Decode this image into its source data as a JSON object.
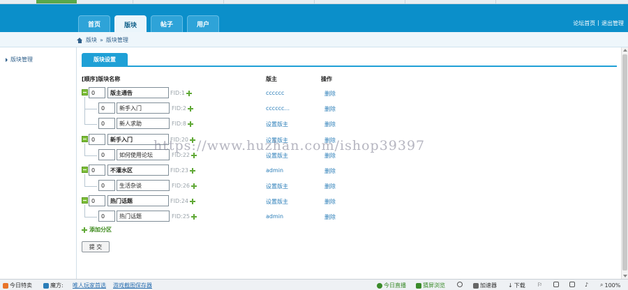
{
  "header": {
    "nav_tabs": [
      "首页",
      "版块",
      "帖子",
      "用户"
    ],
    "active_tab": "版块",
    "links": [
      "论坛首页",
      "|",
      "退出管理"
    ]
  },
  "breadcrumb": {
    "items": [
      "版块",
      "»",
      "版块管理"
    ]
  },
  "sidebar": {
    "items": [
      {
        "label": "版块管理"
      }
    ]
  },
  "panel": {
    "tab_label": "版块设置"
  },
  "columns": {
    "order_name": "[顺序]版块名称",
    "moderator": "版主",
    "action": "操作"
  },
  "rows": [
    {
      "level": 0,
      "order": "0",
      "name": "版主通告",
      "fid": "FID:1",
      "moderator": "cccccc",
      "action": "删除"
    },
    {
      "level": 1,
      "order": "0",
      "name": "新手入门",
      "fid": "FID:2",
      "moderator": "cccccc...",
      "action": "删除"
    },
    {
      "level": 1,
      "order": "0",
      "name": "新人求助",
      "fid": "FID:8",
      "moderator": "设置版主",
      "action": "删除"
    },
    {
      "level": 0,
      "order": "0",
      "name": "新手入门",
      "fid": "FID:20",
      "moderator": "设置版主",
      "action": "删除"
    },
    {
      "level": 1,
      "order": "0",
      "name": "如何使用论坛",
      "fid": "FID:22",
      "moderator": "设置版主",
      "action": "删除"
    },
    {
      "level": 0,
      "order": "0",
      "name": "不灌水区",
      "fid": "FID:23",
      "moderator": "admin",
      "action": "删除"
    },
    {
      "level": 1,
      "order": "0",
      "name": "生活杂谈",
      "fid": "FID:26",
      "moderator": "设置版主",
      "action": "删除"
    },
    {
      "level": 0,
      "order": "0",
      "name": "热门话题",
      "fid": "FID:24",
      "moderator": "设置版主",
      "action": "删除"
    },
    {
      "level": 1,
      "order": "0",
      "name": "热门话题",
      "fid": "FID:25",
      "moderator": "admin",
      "action": "删除"
    }
  ],
  "add_category": "添加分区",
  "submit": "提 交",
  "watermark": "https://www.huzhan.com/ishop39397",
  "statusbar": {
    "left1": "今日特卖",
    "left2": "魔方:",
    "link1": "唯人玩家首选",
    "link2": "游戏截图保存器",
    "right": [
      "今日直播",
      "猜屏浏览",
      "加速器",
      "下载",
      "100%"
    ]
  },
  "colors": {
    "header_bg": "#0b8fca",
    "tab_active": "#1fa0d6",
    "link": "#2a7db8",
    "plus": "#5fa835"
  }
}
